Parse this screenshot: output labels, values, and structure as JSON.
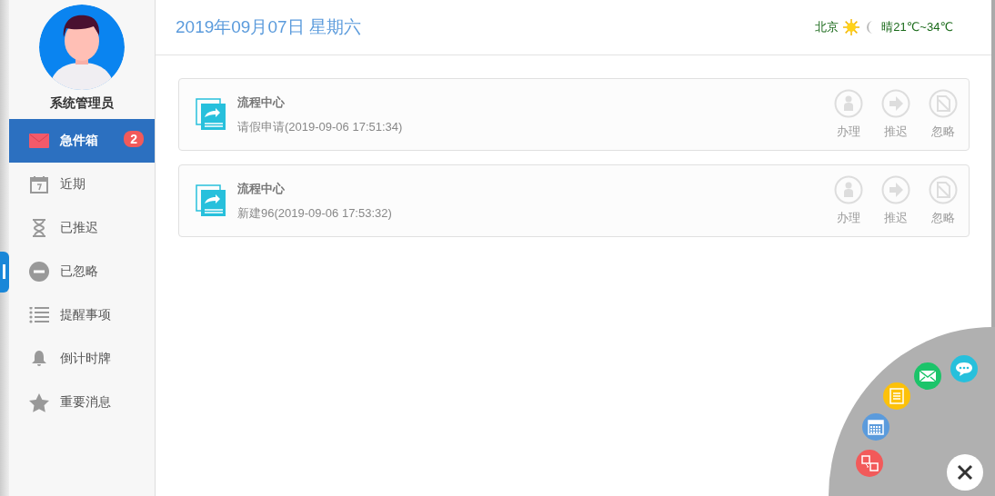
{
  "user": {
    "name": "系统管理员"
  },
  "sidebar": {
    "items": [
      {
        "kind": "mail",
        "label": "急件箱",
        "selected": true,
        "badge": "2"
      },
      {
        "kind": "calendar",
        "label": "近期",
        "selected": false
      },
      {
        "kind": "hourglass",
        "label": "已推迟",
        "selected": false
      },
      {
        "kind": "minus",
        "label": "已忽略",
        "selected": false
      },
      {
        "kind": "list",
        "label": "提醒事项",
        "selected": false
      },
      {
        "kind": "bell",
        "label": "倒计时牌",
        "selected": false
      },
      {
        "kind": "star",
        "label": "重要消息",
        "selected": false
      }
    ]
  },
  "header": {
    "date": "2019年09月07日 星期六",
    "weather": {
      "city": "北京",
      "forecast": "晴21℃~34℃"
    }
  },
  "tasks": [
    {
      "source": "流程中心",
      "title": "请假申请(2019-09-06 17:51:34)",
      "actions": [
        {
          "kind": "handle",
          "label": "办理"
        },
        {
          "kind": "postpone",
          "label": "推迟"
        },
        {
          "kind": "ignore",
          "label": "忽略"
        }
      ]
    },
    {
      "source": "流程中心",
      "title": "新建96(2019-09-06 17:53:32)",
      "actions": [
        {
          "kind": "handle",
          "label": "办理"
        },
        {
          "kind": "postpone",
          "label": "推迟"
        },
        {
          "kind": "ignore",
          "label": "忽略"
        }
      ]
    }
  ],
  "quick_menu": [
    {
      "kind": "transfer",
      "color": "#f25a5a"
    },
    {
      "kind": "calendar",
      "color": "#5b9bdc"
    },
    {
      "kind": "note",
      "color": "#fcc10a"
    },
    {
      "kind": "mail",
      "color": "#1cc46a"
    },
    {
      "kind": "chat",
      "color": "#27c0dc"
    }
  ]
}
